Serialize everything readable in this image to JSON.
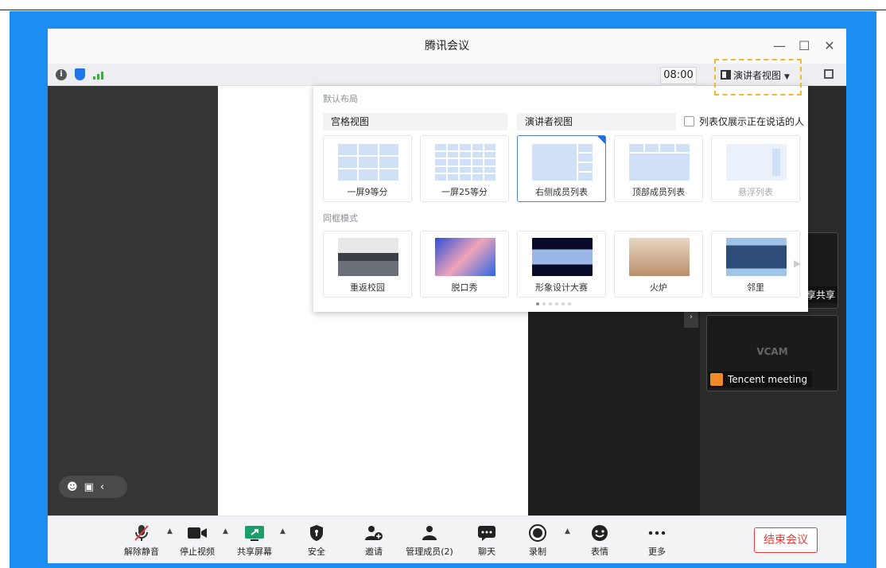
{
  "window": {
    "title": "腾讯会议",
    "controls": [
      "—",
      "☐",
      "✕"
    ]
  },
  "infobar": {
    "time": "08:00",
    "view_button": "演讲者视图"
  },
  "popup": {
    "default_title": "默认布局",
    "tab_grid": "宫格视图",
    "tab_speaker": "演讲者视图",
    "only_speaking": "列表仅展示正在说话的人",
    "layouts": [
      "一屏9等分",
      "一屏25等分",
      "右侧成员列表",
      "顶部成员列表",
      "悬浮列表"
    ],
    "same_frame_title": "同框模式",
    "scenes": [
      "重返校园",
      "脱口秀",
      "形象设计大赛",
      "火炉",
      "邻里"
    ]
  },
  "participants": {
    "tile1_label": "享共享",
    "tile2_vcam": "VCAM",
    "tile2_name": "Tencent meeting"
  },
  "toolbar": {
    "mute": "解除静音",
    "video": "停止视频",
    "share": "共享屏幕",
    "security": "安全",
    "invite": "邀请",
    "members": "管理成员(2)",
    "chat": "聊天",
    "record": "录制",
    "emoji": "表情",
    "more": "更多",
    "end": "结束会议"
  }
}
